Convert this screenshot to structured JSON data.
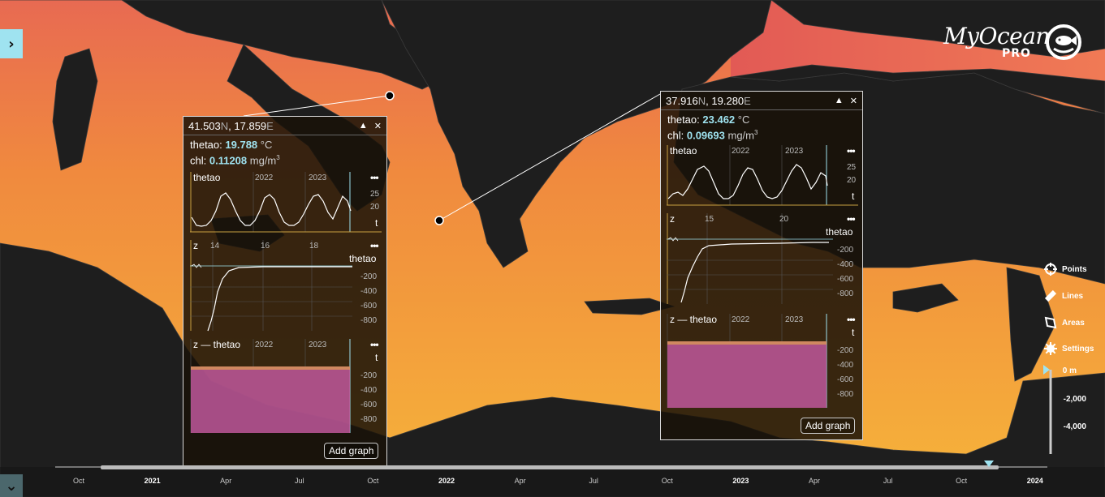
{
  "nav": {
    "expand_icon": "chevron-right-icon",
    "collapse_icon": "chevron-down-icon"
  },
  "logo": {
    "title": "MyOcean",
    "subtitle": "PRO",
    "icon": "fish-logo-icon"
  },
  "panels": [
    {
      "coord_lat": "41.503",
      "coord_lat_hemi": "N",
      "coord_lon": "17.859",
      "coord_lon_hemi": "E",
      "thetao_label": "thetao:",
      "thetao_value": "19.788",
      "thetao_unit": "°C",
      "chl_label": "chl:",
      "chl_value": "0.11208",
      "chl_unit": "mg/m",
      "chart1": {
        "label": "thetao",
        "years": [
          "2022",
          "2023"
        ],
        "yticks": [
          "25",
          "20"
        ],
        "axis": "t"
      },
      "chart2": {
        "axis_z": "z",
        "xticks": [
          "14",
          "16",
          "18"
        ],
        "series": "thetao",
        "yticks": [
          "-200",
          "-400",
          "-600",
          "-800"
        ]
      },
      "chart3": {
        "label": "z — thetao",
        "years": [
          "2022",
          "2023"
        ],
        "axis": "t",
        "yticks": [
          "-200",
          "-400",
          "-600",
          "-800"
        ]
      },
      "more": "•••",
      "add_graph": "Add graph"
    },
    {
      "coord_lat": "37.916",
      "coord_lat_hemi": "N",
      "coord_lon": "19.280",
      "coord_lon_hemi": "E",
      "thetao_label": "thetao:",
      "thetao_value": "23.462",
      "thetao_unit": "°C",
      "chl_label": "chl:",
      "chl_value": "0.09693",
      "chl_unit": "mg/m",
      "chart1": {
        "label": "thetao",
        "years": [
          "2022",
          "2023"
        ],
        "yticks": [
          "25",
          "20"
        ],
        "axis": "t"
      },
      "chart2": {
        "axis_z": "z",
        "xticks": [
          "15",
          "20"
        ],
        "series": "thetao",
        "yticks": [
          "-200",
          "-400",
          "-600",
          "-800"
        ]
      },
      "chart3": {
        "label": "z — thetao",
        "years": [
          "2022",
          "2023"
        ],
        "axis": "t",
        "yticks": [
          "-200",
          "-400",
          "-600",
          "-800"
        ]
      },
      "more": "•••",
      "add_graph": "Add graph"
    }
  ],
  "tools": [
    {
      "label": "Points",
      "icon": "crosshair-icon"
    },
    {
      "label": "Lines",
      "icon": "ruler-icon"
    },
    {
      "label": "Areas",
      "icon": "polygon-icon"
    },
    {
      "label": "Settings",
      "icon": "gear-icon"
    }
  ],
  "depth": {
    "ticks": [
      "0 m",
      "-2,000",
      "-4,000"
    ]
  },
  "timeline": {
    "labels": [
      "Oct",
      "2021",
      "Apr",
      "Jul",
      "Oct",
      "2022",
      "Apr",
      "Jul",
      "Oct",
      "2023",
      "Apr",
      "Jul",
      "Oct",
      "2024"
    ]
  },
  "colors": {
    "accent": "#9fe3f0",
    "sea_warm": "#f4a23a",
    "sea_cool": "#e0654a",
    "land": "#1e1e1e",
    "chart_magenta": "#c0589b"
  }
}
